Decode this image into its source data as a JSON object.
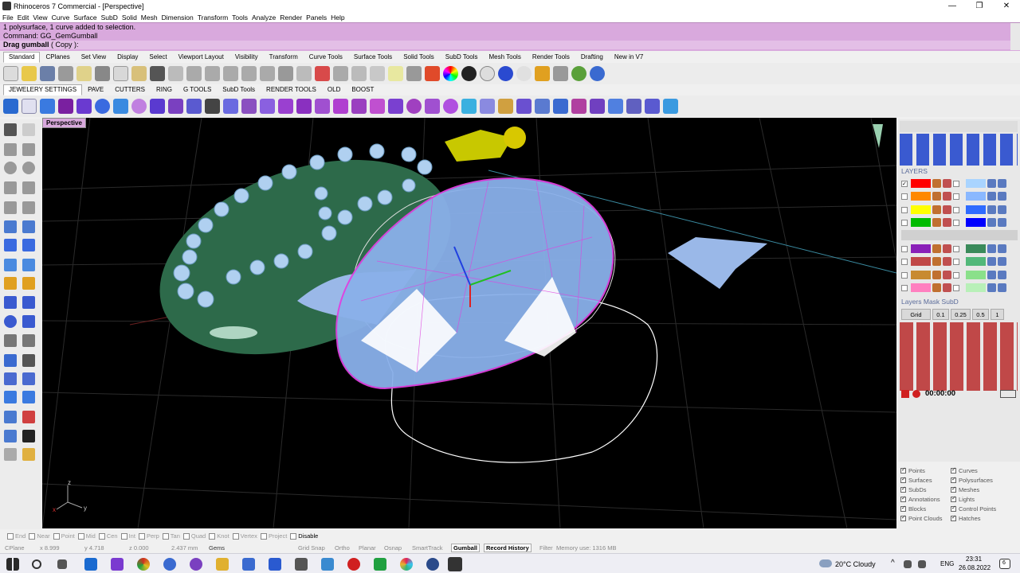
{
  "window": {
    "title": "Rhinoceros 7 Commercial - [Perspective]"
  },
  "menu": [
    "File",
    "Edit",
    "View",
    "Curve",
    "Surface",
    "SubD",
    "Solid",
    "Mesh",
    "Dimension",
    "Transform",
    "Tools",
    "Analyze",
    "Render",
    "Panels",
    "Help"
  ],
  "command": {
    "line1": "1 polysurface, 1 curve added to selection.",
    "line2": "Command: GG_GemGumball",
    "prompt": "Drag gumball",
    "option": "( Copy ):"
  },
  "main_tabs": [
    "Standard",
    "CPlanes",
    "Set View",
    "Display",
    "Select",
    "Viewport Layout",
    "Visibility",
    "Transform",
    "Curve Tools",
    "Surface Tools",
    "Solid Tools",
    "SubD Tools",
    "Mesh Tools",
    "Render Tools",
    "Drafting",
    "New in V7"
  ],
  "plugin_tabs": [
    "JEWELERY SETTINGS",
    "PAVE",
    "CUTTERS",
    "RING",
    "G TOOLS",
    "SubD Tools",
    "RENDER TOOLS",
    "OLD",
    "BOOST"
  ],
  "viewport": {
    "label": "Perspective",
    "axis_x": "x",
    "axis_y": "y",
    "axis_z": "z"
  },
  "layers": {
    "header": "LAYERS",
    "rows": [
      {
        "color": "#ff0000",
        "color2": "#a9d4ff",
        "checked": true
      },
      {
        "color": "#ff8800",
        "color2": "#8ab8ff",
        "checked": false
      },
      {
        "color": "#ffff00",
        "color2": "#2f6bff",
        "checked": false
      },
      {
        "color": "#00bb00",
        "color2": "#0000ff",
        "checked": false
      },
      {
        "color": "#8a20b8",
        "color2": "#3a8a5a",
        "checked": false
      },
      {
        "color": "#c04848",
        "color2": "#52b87a",
        "checked": false
      },
      {
        "color": "#c88a30",
        "color2": "#8ae08a",
        "checked": false
      },
      {
        "color": "#ff80c0",
        "color2": "#b8f0b8",
        "checked": false
      }
    ]
  },
  "subd_panel": {
    "header": "Layers Mask SubD",
    "grid_label": "Grid",
    "grid_values": [
      "0.1",
      "0.25",
      "0.5",
      "1"
    ],
    "timer": "00:00:00"
  },
  "object_filters": {
    "left": [
      "Points",
      "Surfaces",
      "SubDs",
      "Annotations",
      "Blocks",
      "Point Clouds"
    ],
    "right": [
      "Curves",
      "Polysurfaces",
      "Meshes",
      "Lights",
      "Control Points",
      "Hatches"
    ]
  },
  "osnap": [
    "End",
    "Near",
    "Point",
    "Mid",
    "Cen",
    "Int",
    "Perp",
    "Tan",
    "Quad",
    "Knot",
    "Vertex",
    "Project",
    "Disable"
  ],
  "status": {
    "cplane": "CPlane",
    "x": "x 8.999",
    "y": "y 4.718",
    "z": "z 0.000",
    "units": "2.437 mm",
    "layer": "Gems",
    "grid_snap": "Grid Snap",
    "ortho": "Ortho",
    "planar": "Planar",
    "osnap": "Osnap",
    "smarttrack": "SmartTrack",
    "gumball": "Gumball",
    "record_history": "Record History",
    "filter": "Filter",
    "memory": "Memory use: 1316 MB"
  },
  "taskbar": {
    "weather": "20°C  Cloudy",
    "lang": "ENG",
    "time": "23:31",
    "date": "26.08.2022",
    "notif": "6"
  },
  "colors": {
    "cmd_bg": "#d9a9dd",
    "accent": "#5a6b9a"
  }
}
